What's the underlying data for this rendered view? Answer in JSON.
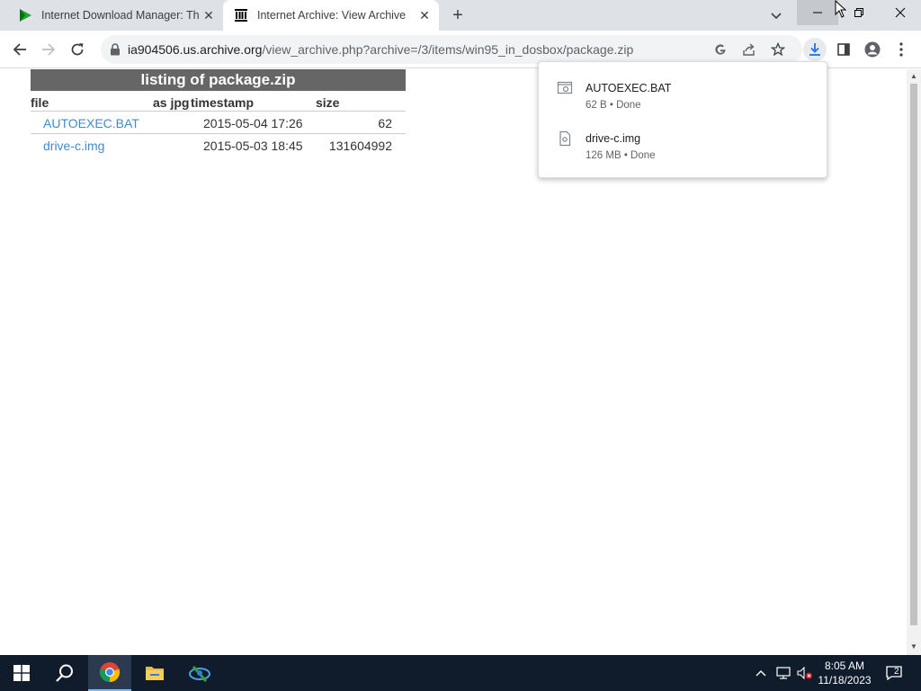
{
  "browser": {
    "tabs": [
      {
        "title": "Internet Download Manager: The",
        "favicon": "idm-play-icon",
        "active": false
      },
      {
        "title": "Internet Archive: View Archive",
        "favicon": "archive-building-icon",
        "active": true
      }
    ],
    "url_host": "ia904506.us.archive.org",
    "url_path": "/view_archive.php?archive=/3/items/win95_in_dosbox/package.zip"
  },
  "listing": {
    "title": "listing of package.zip",
    "headers": {
      "file": "file",
      "as_jpg": "as jpg",
      "timestamp": "timestamp",
      "size": "size"
    },
    "rows": [
      {
        "file": "AUTOEXEC.BAT",
        "timestamp": "2015-05-04 17:26",
        "size": "62"
      },
      {
        "file": "drive-c.img",
        "timestamp": "2015-05-03 18:45",
        "size": "131604992"
      }
    ]
  },
  "downloads": [
    {
      "name": "AUTOEXEC.BAT",
      "status": "62 B • Done"
    },
    {
      "name": "drive-c.img",
      "status": "126 MB • Done"
    }
  ],
  "taskbar": {
    "time": "8:05 AM",
    "date": "11/18/2023",
    "notifications": "2"
  },
  "colors": {
    "link": "#428bca",
    "listing_header_bg": "#666666",
    "download_active": "#1a73e8",
    "taskbar_bg": "#101c2c"
  }
}
